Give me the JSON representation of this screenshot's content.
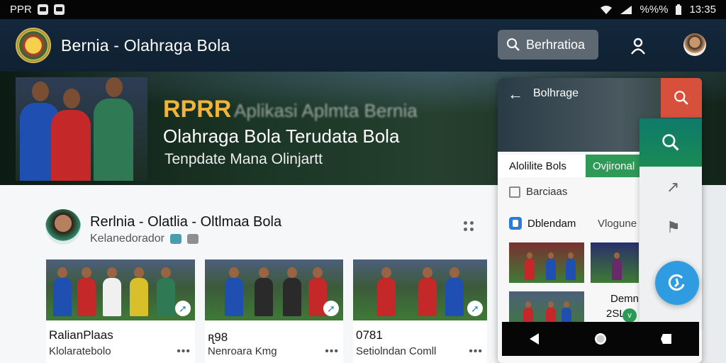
{
  "status_bar": {
    "left_text": "PPR",
    "right_text": "%%%",
    "time": "13:35"
  },
  "app_bar": {
    "title": "Bernia - Olahraga Bola",
    "search_label": "Berhratioa"
  },
  "hero": {
    "brand": "RPRR",
    "tagline": "Aplikasi Aplmta Bernia",
    "title": "Olahraga Bola Terudata Bola",
    "subtitle": "Tenpdate Mana Olinjartt"
  },
  "author": {
    "title": "Rerlnia - Olatlia - Oltlmaa Bola",
    "subtitle": "Kelanedorador"
  },
  "cards": [
    {
      "title": "RalianPlaas",
      "subtitle": "Klolaratebolo"
    },
    {
      "title": "ꭆ98",
      "subtitle": "Nenroara Kmg"
    },
    {
      "title": "0781",
      "subtitle": "Setiolndan Comll"
    }
  ],
  "panel": {
    "title": "Bolhrage",
    "tab_1": "Alolilite Bols",
    "tab_2": "Ovjironal",
    "item_1": "Barciaas",
    "item_2": "Dblendam",
    "item_2_side": "Vlogune",
    "demo_title": "Demniov",
    "demo_score": "2SL",
    "demo_badge": "v"
  },
  "icons": [
    "wifi-icon",
    "signal-icon",
    "battery-icon",
    "search-icon",
    "profile-icon",
    "more-icon",
    "share-icon",
    "back-arrow-icon",
    "edit-icon",
    "trend-icon",
    "bookmark-icon",
    "refresh-icon",
    "nav-back-icon",
    "nav-home-icon",
    "nav-recent-icon"
  ],
  "colors": {
    "app_bar": "#14283c",
    "accent_red": "#d6503c",
    "accent_green": "#2f9a58",
    "fab_blue": "#2f9be0",
    "brand_gold": "#f0b43a"
  }
}
